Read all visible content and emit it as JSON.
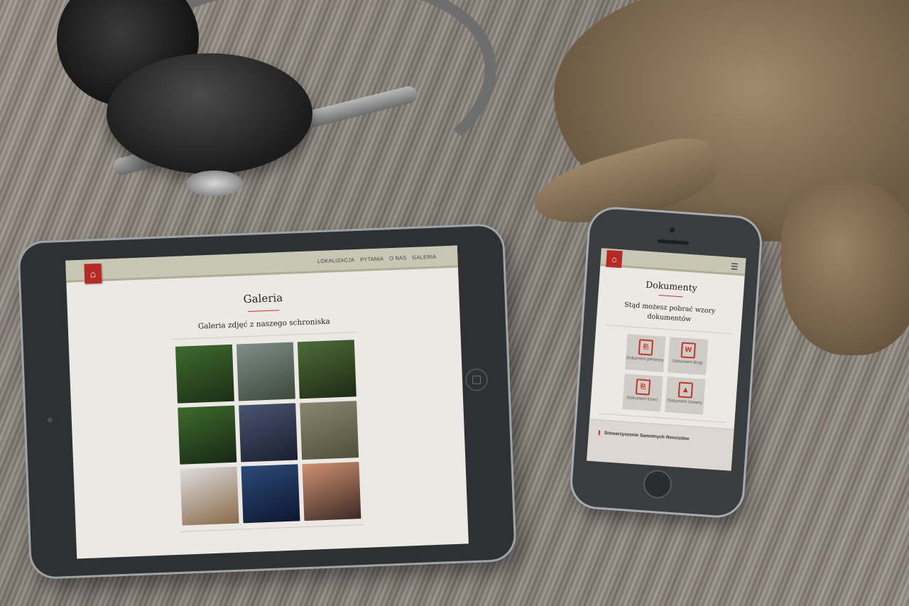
{
  "tablet": {
    "nav": {
      "home_icon": "home-icon",
      "menu": [
        "LOKALIZACJA",
        "PYTANIA",
        "O NAS",
        "GALERIA"
      ]
    },
    "page_title": "Galeria",
    "subtitle": "Galeria zdjęć z naszego schroniska",
    "photo_colors": [
      [
        "#3f6a2e",
        "#1c2e16"
      ],
      [
        "#7f8d8a",
        "#3b4a3a"
      ],
      [
        "#4e6b38",
        "#1d2b15"
      ],
      [
        "#3d6b2b",
        "#182715"
      ],
      [
        "#4a5470",
        "#1a1e30"
      ],
      [
        "#8a8570",
        "#50503a"
      ],
      [
        "#dcdcdc",
        "#8a6a4a"
      ],
      [
        "#2c4a78",
        "#0e1630"
      ],
      [
        "#d09070",
        "#3b2a25"
      ]
    ]
  },
  "phone": {
    "nav": {
      "home_icon": "home-icon",
      "menu_icon": "hamburger-icon"
    },
    "page_title": "Dokumenty",
    "subtitle": "Stąd możesz pobrać wzory dokumentów",
    "documents": [
      {
        "label": "Dokument pierwszy",
        "icon": "pdf-icon",
        "glyph": "⎘"
      },
      {
        "label": "Dokument drugi",
        "icon": "word-icon",
        "glyph": "W"
      },
      {
        "label": "Dokument trzeci",
        "icon": "pdf-icon",
        "glyph": "⎘"
      },
      {
        "label": "Dokument czwarty",
        "icon": "image-icon",
        "glyph": "▲"
      }
    ],
    "footer": "Stowarzyszenie Samotnych Rencistów"
  },
  "colors": {
    "accent": "#b52a24",
    "nav_bg": "#c8c6b4",
    "page_bg": "#ece8e3"
  }
}
